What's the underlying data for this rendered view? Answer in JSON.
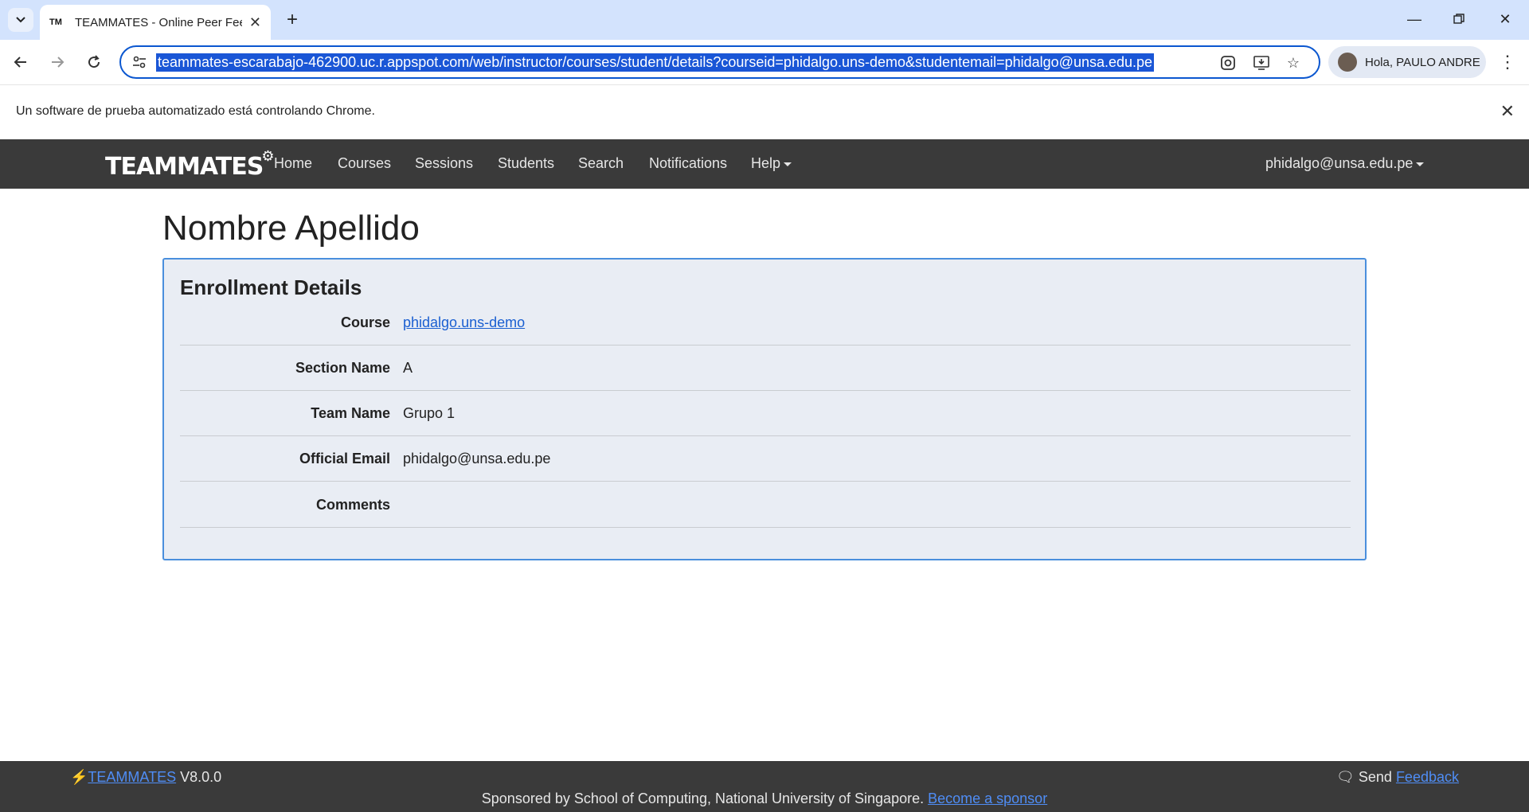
{
  "browser": {
    "tab_title": "TEAMMATES - Online Peer Feedback",
    "tab_favicon": "TM",
    "url": "teammates-escarabajo-462900.uc.r.appspot.com/web/instructor/courses/student/details?courseid=phidalgo.uns-demo&studentemail=phidalgo@unsa.edu.pe",
    "profile_label": "Hola, PAULO ANDRE",
    "automation_message": "Un software de prueba automatizado está controlando Chrome."
  },
  "app_nav": {
    "brand": "TEAMMATES",
    "items": [
      "Home",
      "Courses",
      "Sessions",
      "Students",
      "Search",
      "Notifications",
      "Help"
    ],
    "user": "phidalgo@unsa.edu.pe"
  },
  "page": {
    "title": "Nombre Apellido",
    "card_title": "Enrollment Details",
    "rows": [
      {
        "key": "Course",
        "value": "phidalgo.uns-demo"
      },
      {
        "key": "Section Name",
        "value": "A"
      },
      {
        "key": "Team Name",
        "value": "Grupo 1"
      },
      {
        "key": "Official Email",
        "value": "phidalgo@unsa.edu.pe"
      },
      {
        "key": "Comments",
        "value": ""
      }
    ]
  },
  "footer": {
    "brand_link": "TEAMMATES",
    "version": "V8.0.0",
    "send_label": "Send",
    "feedback_link": "Feedback",
    "sponsor_text": "Sponsored by School of Computing, National University of Singapore.",
    "sponsor_link": "Become a sponsor"
  },
  "colors": {
    "nav_bg": "#3a3a3a",
    "card_bg": "#e9edf4",
    "card_border": "#4a8fdd",
    "link": "#1a5fd1"
  }
}
